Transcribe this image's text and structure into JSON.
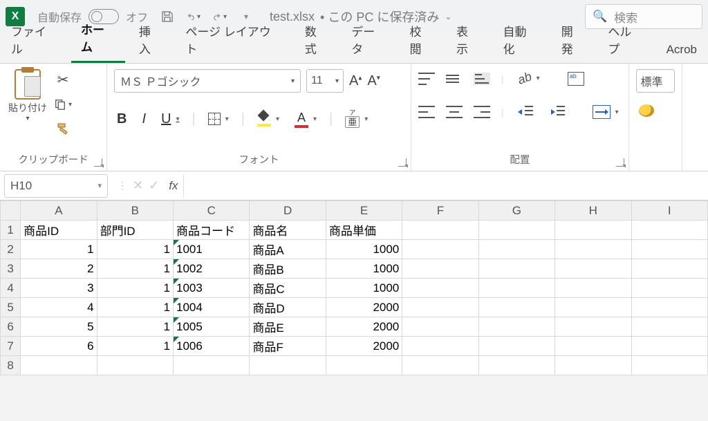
{
  "titlebar": {
    "autosave_label": "自動保存",
    "autosave_state": "オフ",
    "filename": "test.xlsx",
    "saved_hint": "• この PC に保存済み",
    "search_placeholder": "検索"
  },
  "tabs": [
    "ファイル",
    "ホーム",
    "挿入",
    "ページ レイアウト",
    "数式",
    "データ",
    "校閲",
    "表示",
    "自動化",
    "開発",
    "ヘルプ",
    "Acrob"
  ],
  "active_tab": 1,
  "ribbon": {
    "clipboard_label": "クリップボード",
    "paste_label": "貼り付け",
    "font_group_label": "フォント",
    "font_name": "ＭＳ Ｐゴシック",
    "font_size": "11",
    "align_group_label": "配置",
    "number_format": "標準"
  },
  "namebox": "H10",
  "formula": "",
  "columns": [
    "A",
    "B",
    "C",
    "D",
    "E",
    "F",
    "G",
    "H",
    "I"
  ],
  "rows": [
    {
      "n": 1,
      "cells": [
        "商品ID",
        "部門ID",
        "商品コード",
        "商品名",
        "商品単価",
        "",
        "",
        "",
        ""
      ],
      "align": [
        "l",
        "l",
        "l",
        "l",
        "l",
        "",
        "",
        "",
        ""
      ]
    },
    {
      "n": 2,
      "cells": [
        "1",
        "1",
        "1001",
        "商品A",
        "1000",
        "",
        "",
        "",
        ""
      ],
      "align": [
        "r",
        "r",
        "lt",
        "l",
        "r",
        "",
        "",
        "",
        ""
      ]
    },
    {
      "n": 3,
      "cells": [
        "2",
        "1",
        "1002",
        "商品B",
        "1000",
        "",
        "",
        "",
        ""
      ],
      "align": [
        "r",
        "r",
        "lt",
        "l",
        "r",
        "",
        "",
        "",
        ""
      ]
    },
    {
      "n": 4,
      "cells": [
        "3",
        "1",
        "1003",
        "商品C",
        "1000",
        "",
        "",
        "",
        ""
      ],
      "align": [
        "r",
        "r",
        "lt",
        "l",
        "r",
        "",
        "",
        "",
        ""
      ]
    },
    {
      "n": 5,
      "cells": [
        "4",
        "1",
        "1004",
        "商品D",
        "2000",
        "",
        "",
        "",
        ""
      ],
      "align": [
        "r",
        "r",
        "lt",
        "l",
        "r",
        "",
        "",
        "",
        ""
      ]
    },
    {
      "n": 6,
      "cells": [
        "5",
        "1",
        "1005",
        "商品E",
        "2000",
        "",
        "",
        "",
        ""
      ],
      "align": [
        "r",
        "r",
        "lt",
        "l",
        "r",
        "",
        "",
        "",
        ""
      ]
    },
    {
      "n": 7,
      "cells": [
        "6",
        "1",
        "1006",
        "商品F",
        "2000",
        "",
        "",
        "",
        ""
      ],
      "align": [
        "r",
        "r",
        "lt",
        "l",
        "r",
        "",
        "",
        "",
        ""
      ]
    },
    {
      "n": 8,
      "cells": [
        "",
        "",
        "",
        "",
        "",
        "",
        "",
        "",
        ""
      ],
      "align": [
        "",
        "",
        "",
        "",
        "",
        "",
        "",
        "",
        ""
      ]
    }
  ]
}
